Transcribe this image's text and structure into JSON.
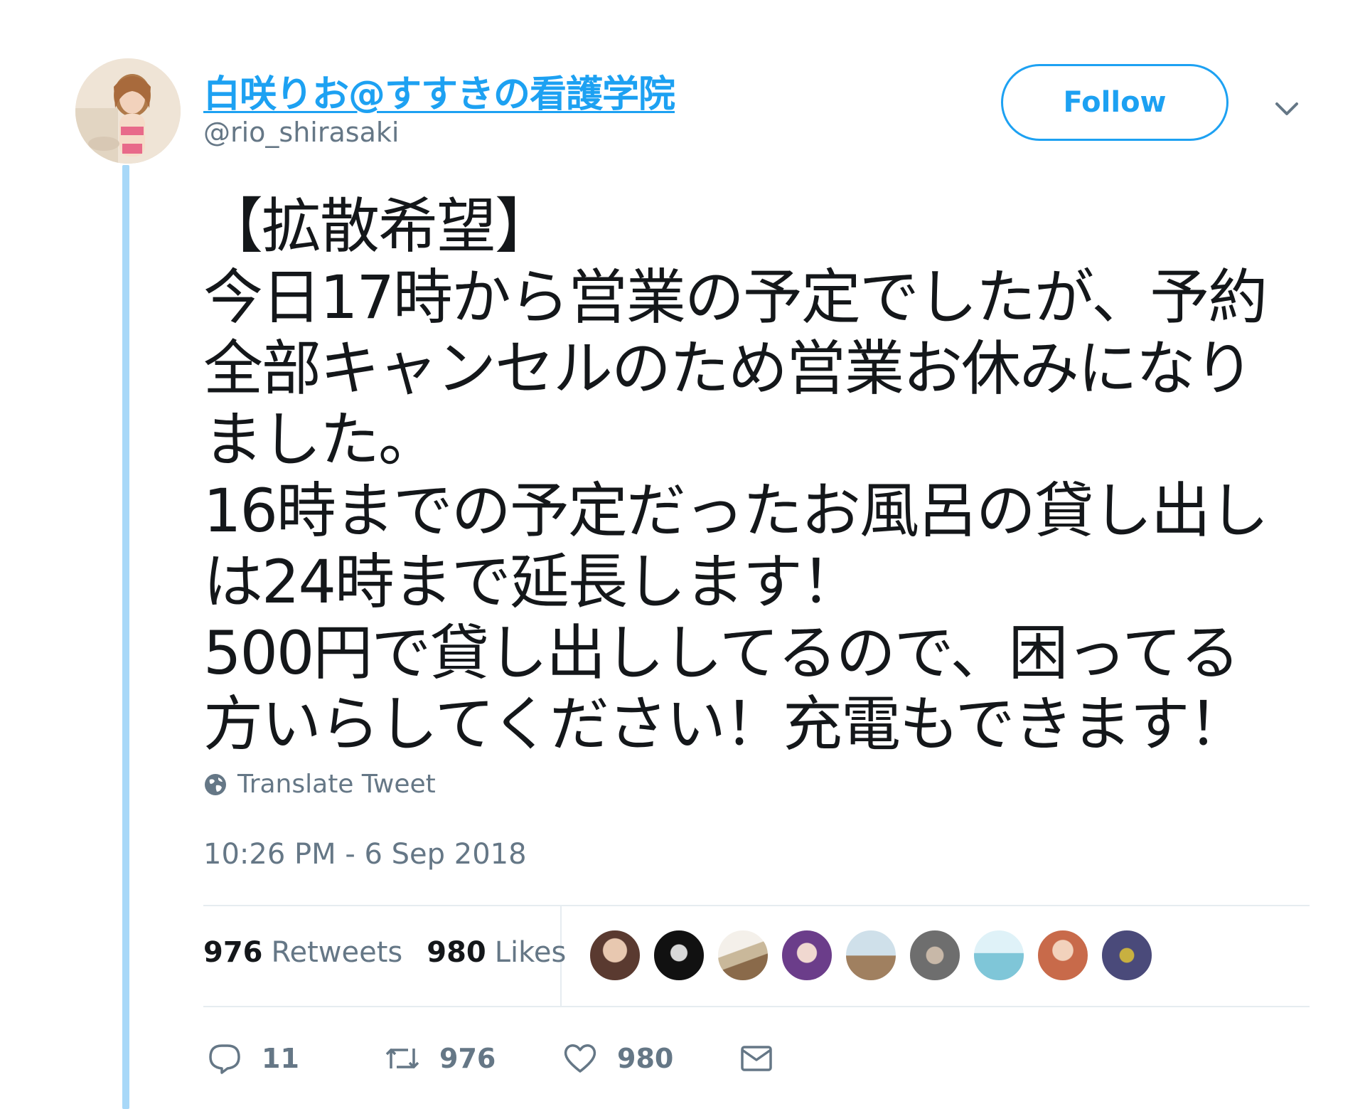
{
  "tweet": {
    "display_name": "白咲りお@すすきの看護学院",
    "handle": "@rio_shirasaki",
    "follow_label": "Follow",
    "text_lines": [
      "【拡散希望】",
      "今日17時から営業の予定でしたが、予約",
      "全部キャンセルのため営業お休みになり",
      "ました。",
      "16時までの予定だったお風呂の貸し出し",
      "は24時まで延長します！",
      "500円で貸し出ししてるので、困ってる",
      "方いらしてください！充電もできます！"
    ],
    "translate_label": "Translate Tweet",
    "timestamp": "10:26 PM - 6 Sep 2018"
  },
  "stats": {
    "retweets_count": "976",
    "retweets_label": "Retweets",
    "likes_count": "980",
    "likes_label": "Likes"
  },
  "likers": [
    {
      "icon": "liker-avatar-1",
      "color": "#5a3a30"
    },
    {
      "icon": "liker-avatar-2",
      "color": "#111111"
    },
    {
      "icon": "liker-avatar-3",
      "color": "#c9b89a"
    },
    {
      "icon": "liker-avatar-4",
      "color": "#6b3d8a"
    },
    {
      "icon": "liker-avatar-5",
      "color": "#a9c3cf"
    },
    {
      "icon": "liker-avatar-6",
      "color": "#6e6e6e"
    },
    {
      "icon": "liker-avatar-7",
      "color": "#7fc6d8"
    },
    {
      "icon": "liker-avatar-8",
      "color": "#c86a4a"
    },
    {
      "icon": "liker-avatar-9",
      "color": "#4a4a7a"
    }
  ],
  "actions": {
    "reply_count": "11",
    "retweet_count": "976",
    "like_count": "980"
  },
  "colors": {
    "accent": "#1da1f2",
    "secondary_text": "#657786",
    "thread_line": "#a8d8f8"
  }
}
